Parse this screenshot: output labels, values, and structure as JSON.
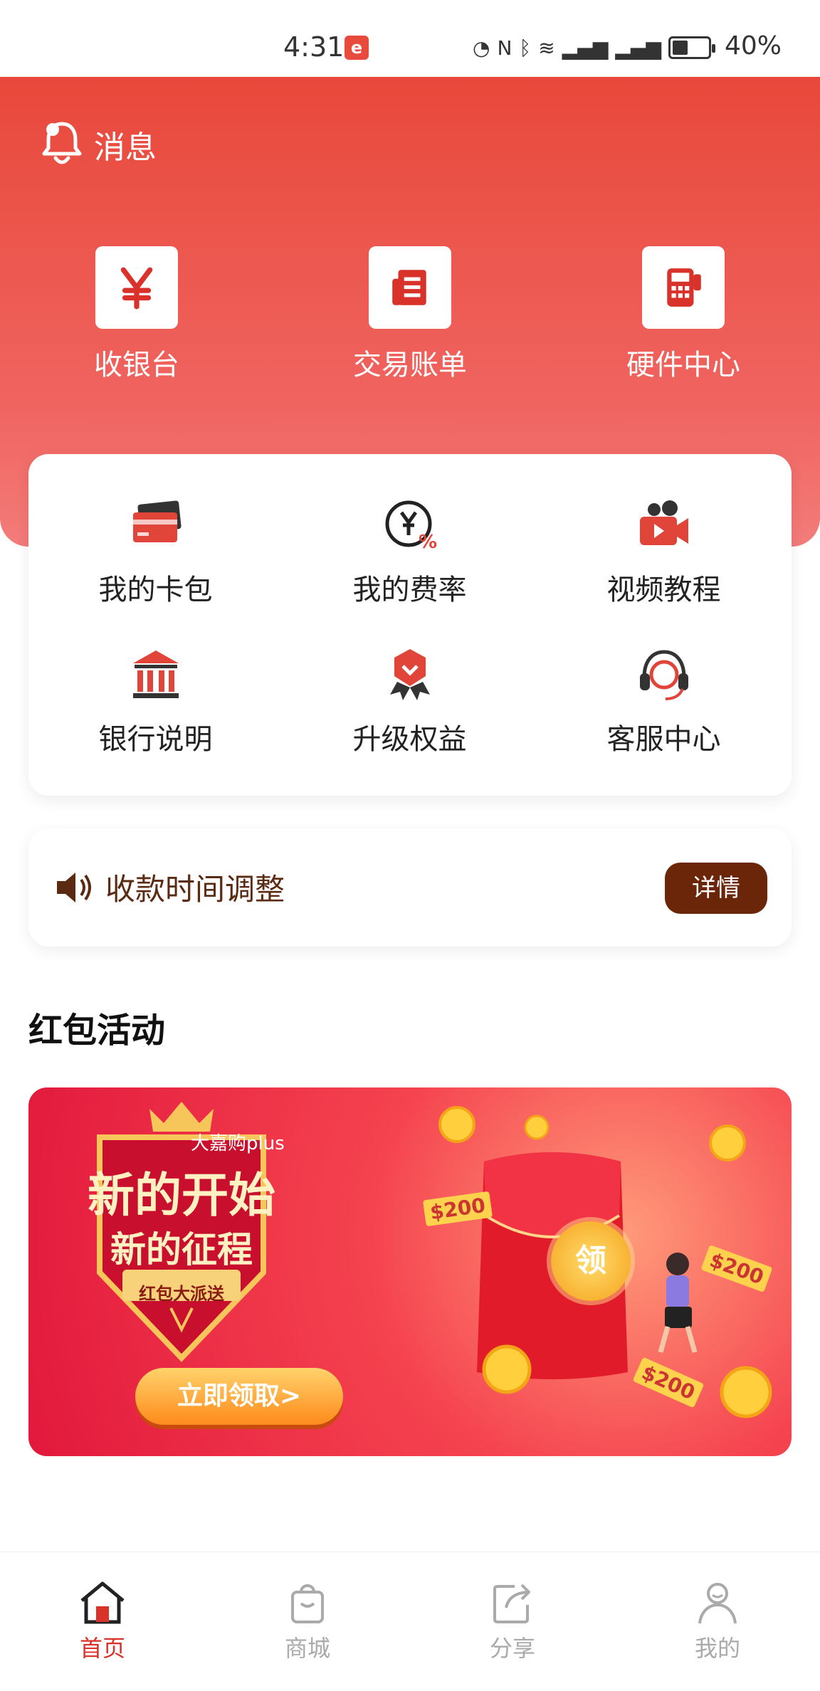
{
  "status_bar": {
    "time": "4:31",
    "battery": "40%"
  },
  "header": {
    "message_label": "消息",
    "top_actions": [
      {
        "label": "收银台",
        "icon": "yen-icon"
      },
      {
        "label": "交易账单",
        "icon": "bill-icon"
      },
      {
        "label": "硬件中心",
        "icon": "pos-terminal-icon"
      }
    ]
  },
  "grid": [
    {
      "label": "我的卡包",
      "icon": "card-wallet-icon"
    },
    {
      "label": "我的费率",
      "icon": "rate-icon"
    },
    {
      "label": "视频教程",
      "icon": "video-camera-icon"
    },
    {
      "label": "银行说明",
      "icon": "bank-icon"
    },
    {
      "label": "升级权益",
      "icon": "badge-icon"
    },
    {
      "label": "客服中心",
      "icon": "headset-icon"
    }
  ],
  "notice": {
    "text": "收款时间调整",
    "button": "详情"
  },
  "section": {
    "title": "红包活动"
  },
  "banner": {
    "brand": "大嘉购plus",
    "title_line1": "新的开始",
    "title_line2": "新的征程",
    "tag": "红包大派送",
    "cta": "立即领取>",
    "envelope_label": "领",
    "money_tag1": "$200",
    "money_tag2": "$200",
    "money_tag3": "$200"
  },
  "bottom_nav": [
    {
      "label": "首页",
      "icon": "home-icon",
      "active": true
    },
    {
      "label": "商城",
      "icon": "shopping-bag-icon",
      "active": false
    },
    {
      "label": "分享",
      "icon": "share-icon",
      "active": false
    },
    {
      "label": "我的",
      "icon": "profile-icon",
      "active": false
    }
  ],
  "colors": {
    "primary": "#e8483a",
    "notice_button": "#6b2508",
    "active_nav": "#d8322a"
  }
}
